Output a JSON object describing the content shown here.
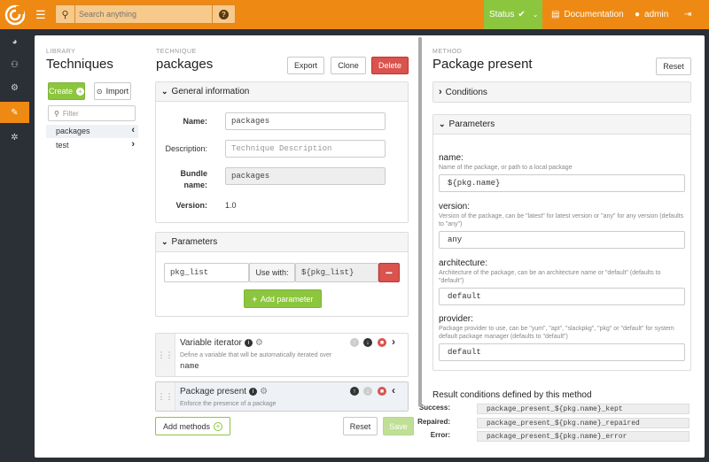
{
  "topbar": {
    "search_placeholder": "Search anything",
    "status_label": "Status",
    "documentation_label": "Documentation",
    "user_label": "admin"
  },
  "library": {
    "sublabel": "Library",
    "title": "Techniques",
    "create_label": "Create",
    "import_label": "Import",
    "filter_placeholder": "Filter",
    "items": [
      {
        "label": "packages"
      },
      {
        "label": "test"
      }
    ]
  },
  "technique": {
    "sublabel": "Technique",
    "title": "packages",
    "export_label": "Export",
    "clone_label": "Clone",
    "delete_label": "Delete",
    "general_header": "General information",
    "name_label": "Name:",
    "name_value": "packages",
    "description_label": "Description:",
    "description_placeholder": "Technique Description",
    "bundle_label_1": "Bundle",
    "bundle_label_2": "name:",
    "bundle_value": "packages",
    "version_label": "Version:",
    "version_value": "1.0",
    "parameters_header": "Parameters",
    "param_name": "pkg_list",
    "use_with_label": "Use with:",
    "use_with_value": "${pkg_list}",
    "add_parameter_label": "Add parameter",
    "methods": [
      {
        "title": "Variable iterator",
        "description": "Define a variable that will be automatically iterated over",
        "value": "name"
      },
      {
        "title": "Package present",
        "description": "Enforce the presence of a package",
        "value": ""
      }
    ],
    "add_methods_label": "Add methods",
    "reset_label": "Reset",
    "save_label": "Save"
  },
  "method": {
    "sublabel": "Method",
    "title": "Package present",
    "reset_label": "Reset",
    "conditions_header": "Conditions",
    "parameters_header": "Parameters",
    "params": [
      {
        "label": "name:",
        "description": "Name of the package, or path to a local package",
        "value": "${pkg.name}"
      },
      {
        "label": "version:",
        "description": "Version of the package, can be \"latest\" for latest version or \"any\" for any version (defaults to \"any\")",
        "value": "any"
      },
      {
        "label": "architecture:",
        "description": "Architecture of the package, can be an architecture name or \"default\" (defaults to \"default\")",
        "value": "default"
      },
      {
        "label": "provider:",
        "description": "Package provider to use, can be \"yum\", \"apt\", \"slackpkg\", \"pkg\" or \"default\" for system default package manager (defaults to \"default\")",
        "value": "default"
      }
    ],
    "result_title": "Result conditions defined by this method",
    "results": [
      {
        "label": "Success:",
        "value": "package_present_${pkg.name}_kept"
      },
      {
        "label": "Repaired:",
        "value": "package_present_${pkg.name}_repaired"
      },
      {
        "label": "Error:",
        "value": "package_present_${pkg.name}_error"
      }
    ]
  },
  "colors": {
    "brand": "#ee8a13",
    "success": "#8cc63f",
    "danger": "#d9534f",
    "sidebar": "#2b2f36"
  }
}
